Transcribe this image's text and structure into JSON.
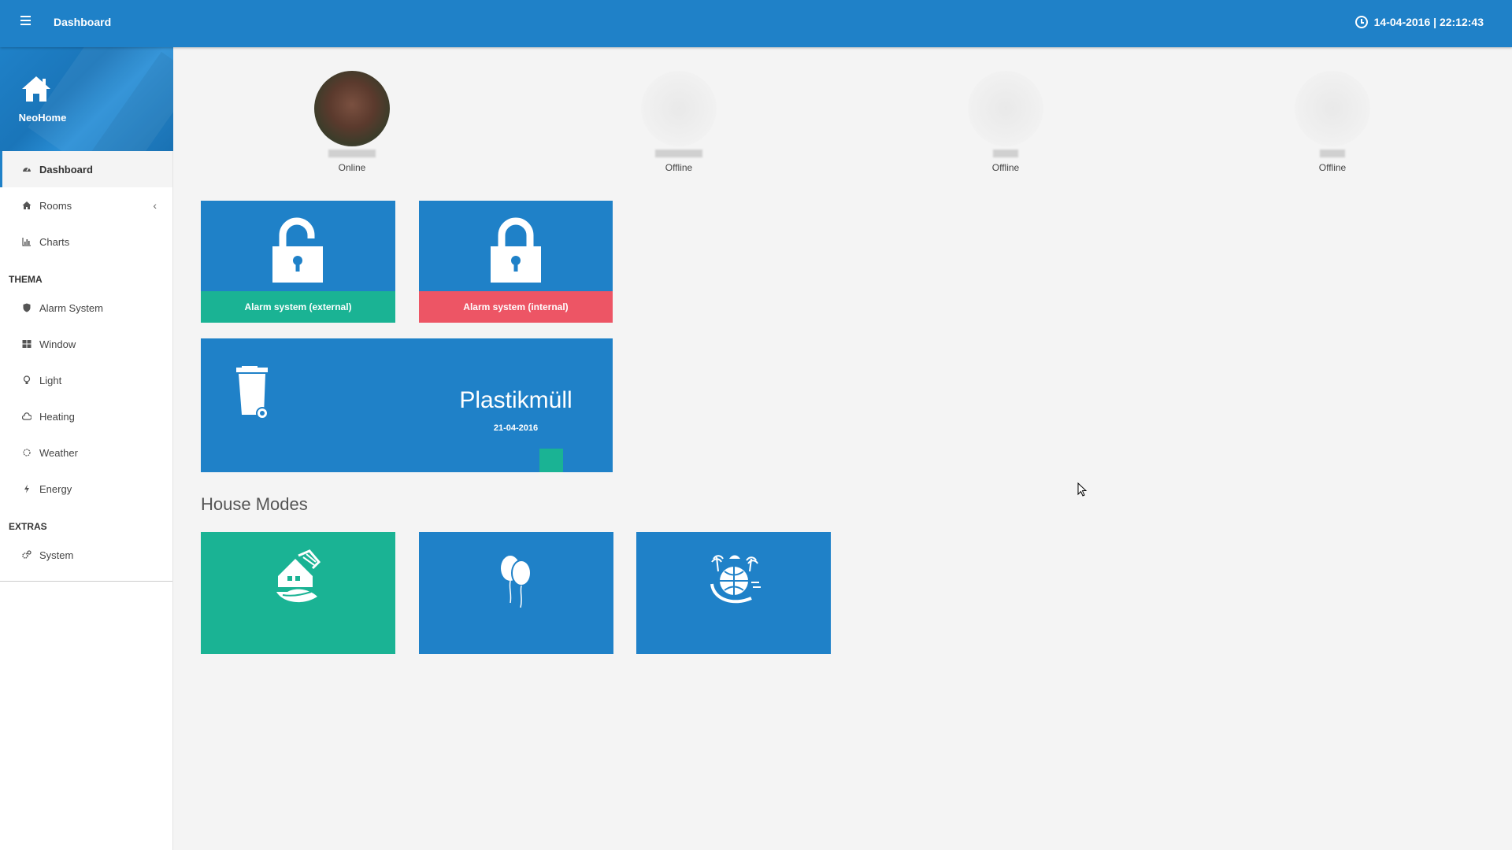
{
  "header": {
    "title": "Dashboard",
    "datetime": "14-04-2016 | 22:12:43"
  },
  "sidebar": {
    "brand": "NeoHome",
    "main_items": [
      {
        "label": "Dashboard",
        "icon": "dashboard-icon"
      },
      {
        "label": "Rooms",
        "icon": "home-icon"
      },
      {
        "label": "Charts",
        "icon": "bar-chart-icon"
      }
    ],
    "section_thema": "THEMA",
    "thema_items": [
      {
        "label": "Alarm System",
        "icon": "shield-icon"
      },
      {
        "label": "Window",
        "icon": "window-icon"
      },
      {
        "label": "Light",
        "icon": "lightbulb-icon"
      },
      {
        "label": "Heating",
        "icon": "cloud-icon"
      },
      {
        "label": "Weather",
        "icon": "sun-icon"
      },
      {
        "label": "Energy",
        "icon": "bolt-icon"
      }
    ],
    "section_extras": "EXTRAS",
    "extras_items": [
      {
        "label": "System",
        "icon": "gears-icon"
      }
    ]
  },
  "users": [
    {
      "status": "Online"
    },
    {
      "status": "Offline"
    },
    {
      "status": "Offline"
    },
    {
      "status": "Offline"
    }
  ],
  "alarm_tiles": [
    {
      "label": "Alarm system (external)",
      "state": "unlocked",
      "footer_color": "#1ab394"
    },
    {
      "label": "Alarm system (internal)",
      "state": "locked",
      "footer_color": "#ed5565"
    }
  ],
  "waste": {
    "title": "Plastikmüll",
    "date": "21-04-2016"
  },
  "house_modes": {
    "title": "House Modes",
    "modes": [
      {
        "icon": "eco-house-icon",
        "color": "#1ab394"
      },
      {
        "icon": "balloons-icon",
        "color": "#1f81c8"
      },
      {
        "icon": "vacation-globe-icon",
        "color": "#1f81c8"
      }
    ]
  },
  "colors": {
    "primary": "#1f81c8",
    "green": "#1ab394",
    "red": "#ed5565"
  }
}
